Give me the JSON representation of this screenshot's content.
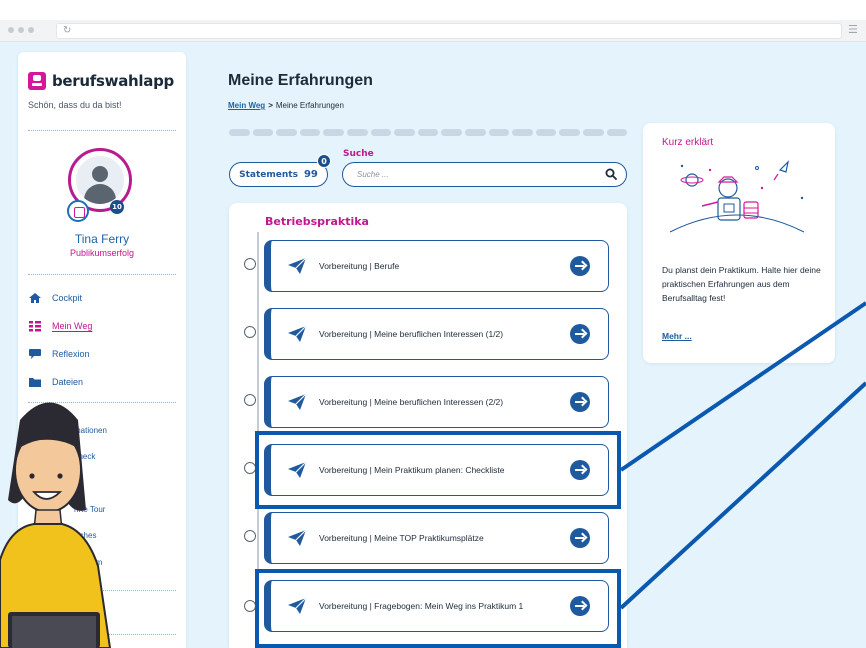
{
  "app": {
    "brand_name": "berufswahlapp",
    "tagline": "Schön, dass du da bist!",
    "accent_color": "#c2168f",
    "primary_color": "#1f5a9e"
  },
  "user": {
    "name": "Tina Ferry",
    "role": "Publikumserfolg",
    "badge_count": "10",
    "avatar_icon": "user-avatar-icon"
  },
  "nav": {
    "items": [
      {
        "label": "Cockpit",
        "icon": "home-icon"
      },
      {
        "label": "Mein Weg",
        "icon": "path-icon",
        "active": true
      },
      {
        "label": "Reflexion",
        "icon": "chat-bubble-icon"
      },
      {
        "label": "Dateien",
        "icon": "folder-icon"
      }
    ],
    "secondary": [
      {
        "label": "Informationen"
      },
      {
        "label": "-Check"
      },
      {
        "label": "hrte Tour"
      },
      {
        "label": "liches"
      },
      {
        "label": "ressum"
      },
      {
        "label": "den"
      }
    ]
  },
  "main": {
    "title": "Meine Erfahrungen",
    "breadcrumb": {
      "link": "Mein Weg",
      "separator": ">",
      "current": "Meine Erfahrungen"
    },
    "progress_steps": 17,
    "statements": {
      "label": "Statements",
      "glyph": "99",
      "badge": "0"
    },
    "search": {
      "label": "Suche",
      "placeholder": "Suche ..."
    },
    "section_title": "Betriebspraktika",
    "cards": [
      {
        "title": "Vorbereitung | Berufe"
      },
      {
        "title": "Vorbereitung | Meine beruflichen Interessen (1/2)"
      },
      {
        "title": "Vorbereitung | Meine beruflichen Interessen (2/2)"
      },
      {
        "title": "Vorbereitung | Mein Praktikum planen: Checkliste",
        "highlighted": true
      },
      {
        "title": "Vorbereitung | Meine TOP Praktikumsplätze"
      },
      {
        "title": "Vorbereitung | Fragebogen: Mein Weg ins Praktikum 1",
        "highlighted": true
      }
    ]
  },
  "info": {
    "title": "Kurz erklärt",
    "text": "Du planst dein Praktikum. Halte hier deine praktischen Erfahrungen aus dem Berufsalltag fest!",
    "more_link": "Mehr ..."
  }
}
